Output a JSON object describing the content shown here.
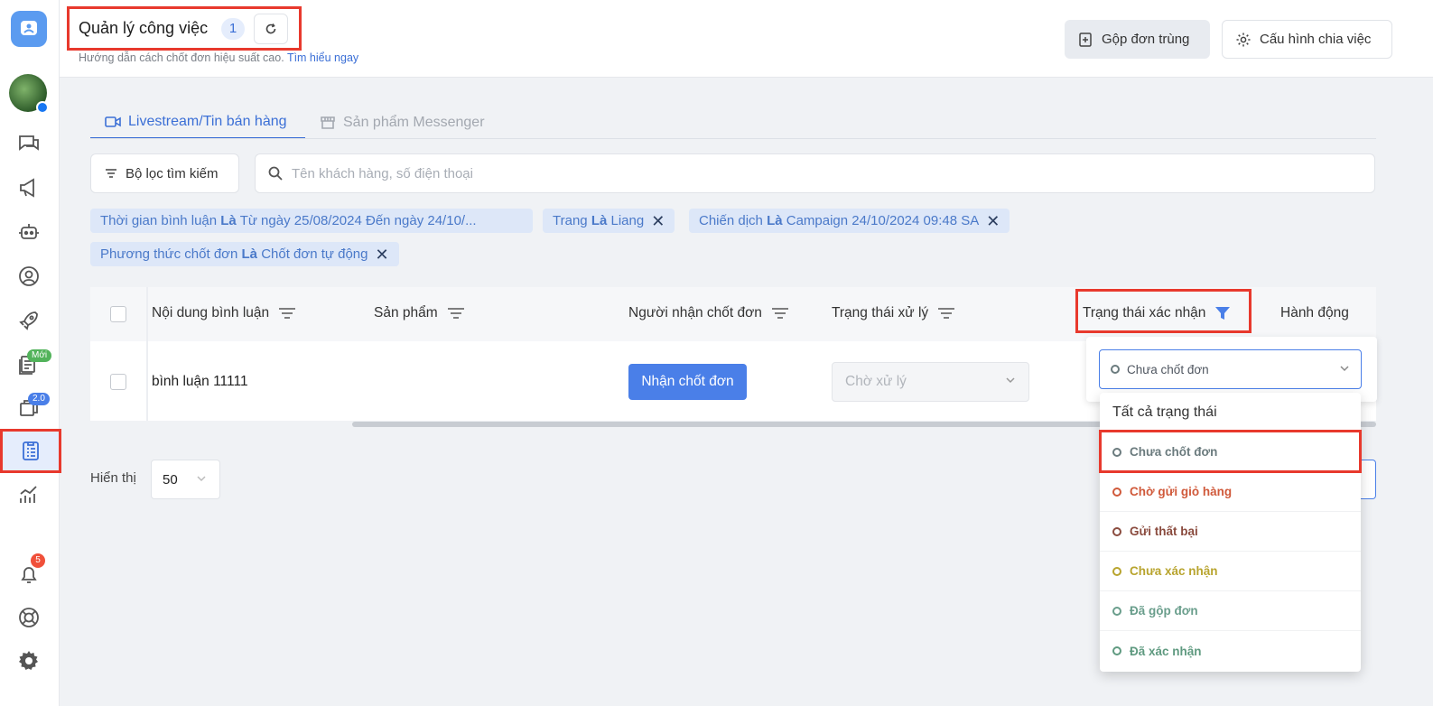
{
  "header": {
    "title": "Quản lý công việc",
    "count": "1",
    "subtitle": "Hướng dẫn cách chốt đơn hiệu suất cao.",
    "subtitle_link": "Tìm hiểu ngay",
    "merge_button": "Gộp đơn trùng",
    "config_button": "Cấu hình chia việc"
  },
  "sidebar": {
    "badge_new": "Mới",
    "badge_version": "2.0",
    "notification_count": "5"
  },
  "tabs": [
    {
      "label": "Livestream/Tin bán hàng",
      "active": true
    },
    {
      "label": "Sản phẩm Messenger",
      "active": false
    }
  ],
  "filter_button": "Bộ lọc tìm kiếm",
  "search": {
    "placeholder": "Tên khách hàng, số điện thoại"
  },
  "chips": [
    {
      "field": "Thời gian bình luận",
      "op": "Là",
      "value": "Từ ngày 25/08/2024 Đến ngày 24/10/..."
    },
    {
      "field": "Trang",
      "op": "Là",
      "value": "Liang"
    },
    {
      "field": "Chiến dịch",
      "op": "Là",
      "value": "Campaign 24/10/2024 09:48 SA"
    },
    {
      "field": "Phương thức chốt đơn",
      "op": "Là",
      "value": "Chốt đơn tự động"
    }
  ],
  "table": {
    "columns": [
      "Nội dung bình luận",
      "Sản phẩm",
      "Người nhận chốt đơn",
      "Trạng thái xử lý",
      "Trạng thái xác nhận",
      "Hành động"
    ],
    "rows": [
      {
        "comment": "bình luận 11111",
        "action_button": "Nhận chốt đơn",
        "process_status": "Chờ xử lý"
      }
    ]
  },
  "pagination": {
    "label": "Hiển thị",
    "page_size": "50"
  },
  "status_filter": {
    "selected": "Chưa chốt đơn",
    "options": [
      {
        "label": "Tất cả trạng thái",
        "color": ""
      },
      {
        "label": "Chưa chốt đơn",
        "color": "#6b7b7e"
      },
      {
        "label": "Chờ gửi giỏ hàng",
        "color": "#d0593a"
      },
      {
        "label": "Gửi thất bại",
        "color": "#8a4b3e"
      },
      {
        "label": "Chưa xác nhận",
        "color": "#b8a42e"
      },
      {
        "label": "Đã gộp đơn",
        "color": "#6a9e8c"
      },
      {
        "label": "Đã xác nhận",
        "color": "#5f9a80"
      }
    ]
  },
  "colors": {
    "primary": "#4a7fe8",
    "highlight": "#e8392d"
  }
}
